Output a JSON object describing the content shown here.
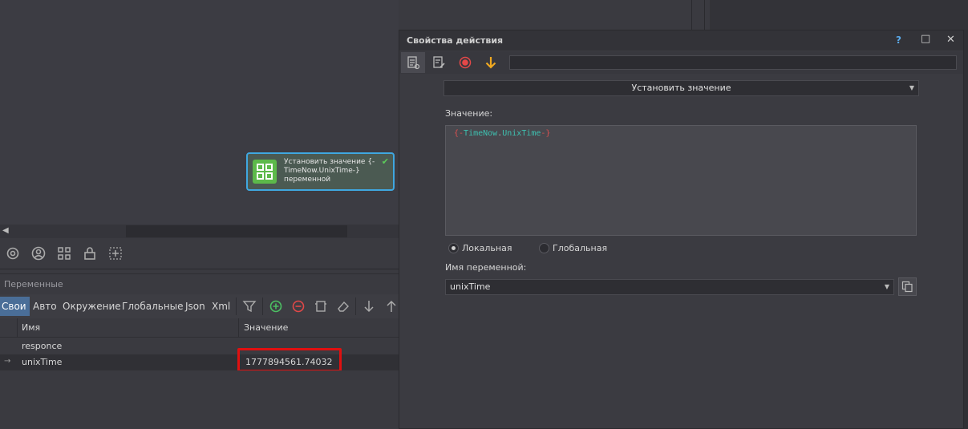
{
  "node": {
    "line1": "Установить значение {-",
    "line2": "TimeNow.UnixTime-}",
    "line3": "переменной",
    "icon": "grid-icon",
    "status_icon": "check-icon"
  },
  "variables_panel": {
    "title": "Переменные",
    "tabs": [
      {
        "label": "Свои",
        "active": true
      },
      {
        "label": "Авто"
      },
      {
        "label": "Окружение"
      },
      {
        "label": "Глобальные"
      },
      {
        "label": "Json"
      },
      {
        "label": "Xml"
      }
    ],
    "columns": {
      "name": "Имя",
      "value": "Значение"
    },
    "rows": [
      {
        "name": "responce",
        "value": ""
      },
      {
        "name": "unixTime",
        "value": "1777894561.74032"
      }
    ]
  },
  "dialog": {
    "title": "Свойства действия",
    "help": "?",
    "maximize": "□",
    "close": "✕",
    "action": "Установить значение",
    "value_label": "Значение:",
    "value_parts": {
      "open": "{-",
      "obj": "TimeNow",
      "dot": ".",
      "prop": "UnixTime",
      "close": "-}"
    },
    "scope": {
      "local": "Локальная",
      "global": "Глобальная",
      "selected": "local"
    },
    "varname_label": "Имя переменной:",
    "varname": "unixTime"
  },
  "colors": {
    "accent": "#4a6e98",
    "node_border": "#3fa7e0",
    "highlight": "#e01010"
  }
}
